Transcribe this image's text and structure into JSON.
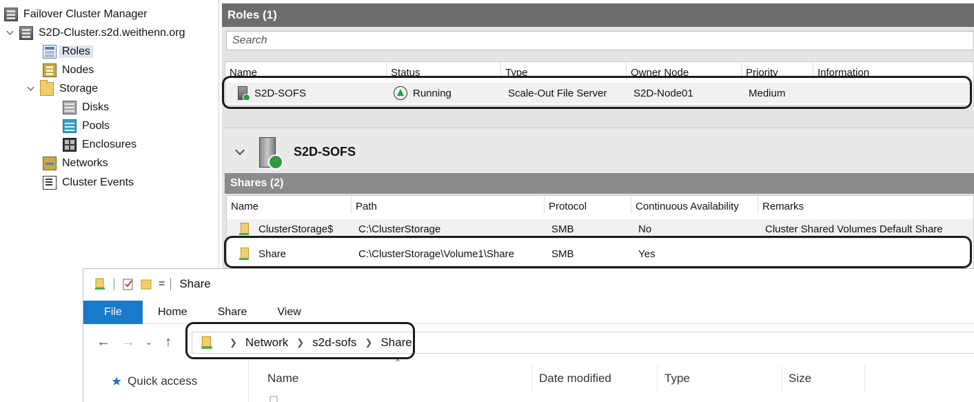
{
  "tree": {
    "root_label": "Failover Cluster Manager",
    "cluster_label": "S2D-Cluster.s2d.weithenn.org",
    "items": [
      {
        "label": "Roles"
      },
      {
        "label": "Nodes"
      },
      {
        "label": "Storage"
      },
      {
        "label": "Disks"
      },
      {
        "label": "Pools"
      },
      {
        "label": "Enclosures"
      },
      {
        "label": "Networks"
      },
      {
        "label": "Cluster Events"
      }
    ]
  },
  "roles": {
    "title": "Roles (1)",
    "search_placeholder": "Search",
    "columns": [
      "Name",
      "Status",
      "Type",
      "Owner Node",
      "Priority",
      "Information"
    ],
    "rows": [
      {
        "name": "S2D-SOFS",
        "status": "Running",
        "type": "Scale-Out File Server",
        "owner": "S2D-Node01",
        "priority": "Medium",
        "information": ""
      }
    ]
  },
  "detail": {
    "title": "S2D-SOFS",
    "shares_title": "Shares (2)",
    "columns": [
      "Name",
      "Path",
      "Protocol",
      "Continuous Availability",
      "Remarks"
    ],
    "rows": [
      {
        "name": "ClusterStorage$",
        "path": "C:\\ClusterStorage",
        "protocol": "SMB",
        "ca": "No",
        "remarks": "Cluster Shared Volumes Default Share"
      },
      {
        "name": "Share",
        "path": "C:\\ClusterStorage\\Volume1\\Share",
        "protocol": "SMB",
        "ca": "Yes",
        "remarks": ""
      }
    ]
  },
  "explorer": {
    "title": "Share",
    "qat_dropdown": "=",
    "tabs": [
      "File",
      "Home",
      "Share",
      "View"
    ],
    "breadcrumb": [
      "Network",
      "s2d-sofs",
      "Share"
    ],
    "quick_access": "Quick access",
    "columns": [
      "Name",
      "Date modified",
      "Type",
      "Size"
    ]
  }
}
